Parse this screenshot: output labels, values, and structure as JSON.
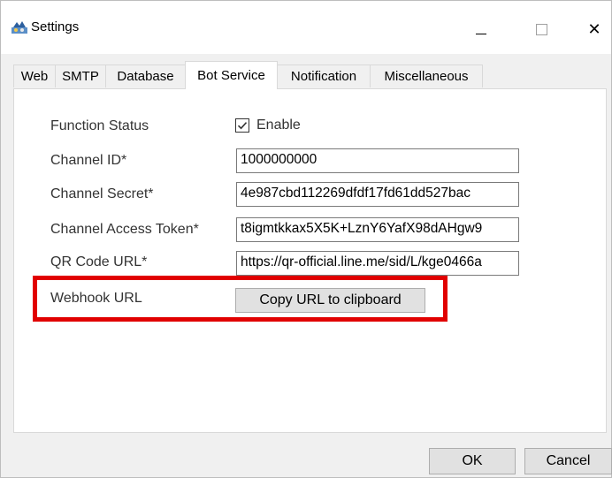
{
  "window": {
    "title": "Settings",
    "icons": {
      "app": "settings-app-icon",
      "minimize": "minimize-icon",
      "maximize": "maximize-icon",
      "close": "close-icon"
    },
    "close_glyph": "✕"
  },
  "tabs": [
    {
      "label": "Web",
      "active": false
    },
    {
      "label": "SMTP",
      "active": false
    },
    {
      "label": "Database",
      "active": false
    },
    {
      "label": "Bot Service",
      "active": true
    },
    {
      "label": "Notification",
      "active": false
    },
    {
      "label": "Miscellaneous",
      "active": false
    }
  ],
  "form": {
    "function_status": {
      "label": "Function Status",
      "checkbox_label": "Enable",
      "checked": true
    },
    "channel_id": {
      "label": "Channel ID*",
      "value": "1000000000"
    },
    "channel_secret": {
      "label": "Channel Secret*",
      "value": "4e987cbd112269dfdf17fd61dd527bac"
    },
    "channel_access_token": {
      "label": "Channel Access Token*",
      "value": "t8igmtkkax5X5K+LznY6YafX98dAHgw9"
    },
    "qr_code_url": {
      "label": "QR Code URL*",
      "value": "https://qr-official.line.me/sid/L/kge0466a"
    },
    "webhook_url": {
      "label": "Webhook URL",
      "button": "Copy URL to clipboard"
    }
  },
  "footer": {
    "ok": "OK",
    "cancel": "Cancel"
  },
  "colors": {
    "highlight": "#e10000",
    "checkmark": "#333333"
  }
}
